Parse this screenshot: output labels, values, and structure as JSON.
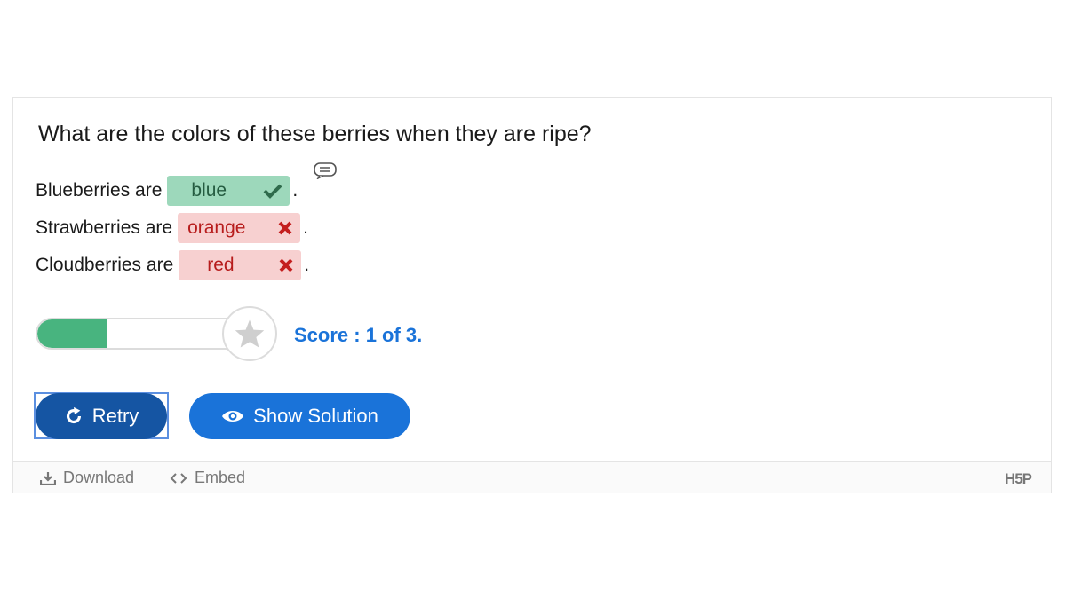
{
  "question": "What are the colors of these berries when they are ripe?",
  "rows": [
    {
      "label": "Blueberries are",
      "answer": "blue",
      "status": "correct",
      "suffix": "."
    },
    {
      "label": "Strawberries are",
      "answer": "orange",
      "status": "wrong",
      "suffix": "."
    },
    {
      "label": "Cloudberries are",
      "answer": "red",
      "status": "wrong",
      "suffix": "."
    }
  ],
  "progress": {
    "fraction": 0.333,
    "icon": "star-icon"
  },
  "score_text": "Score : 1 of 3.",
  "buttons": {
    "retry": "Retry",
    "show_solution": "Show Solution"
  },
  "footer": {
    "download": "Download",
    "embed": "Embed",
    "logo": "H5P"
  },
  "colors": {
    "correct_bg": "#9dd8bb",
    "wrong_bg": "#f7d0d0",
    "primary": "#1a73d9",
    "retry": "#1555a3",
    "progress": "#48b47f"
  }
}
